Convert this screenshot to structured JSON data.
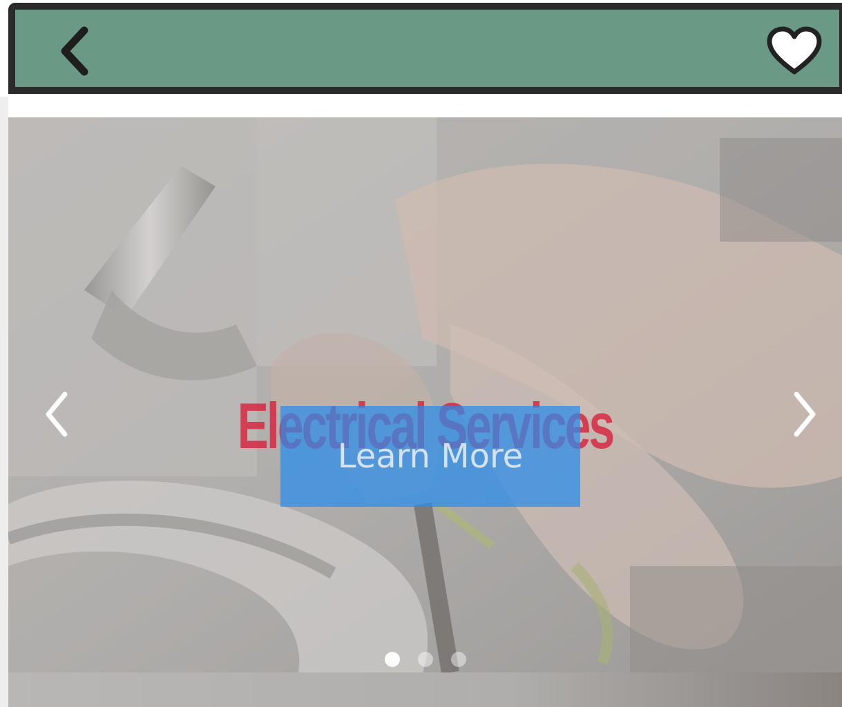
{
  "header": {
    "back_icon": "chevron-left-icon",
    "favorite_icon": "heart-icon",
    "background_color": "#6a9a85",
    "border_color": "#2b2b2b"
  },
  "carousel": {
    "title": "Electrical Services",
    "cta_label": "Learn More",
    "prev_icon": "chevron-left-icon",
    "next_icon": "chevron-right-icon",
    "slide_count": 3,
    "active_slide": 1,
    "title_color": "#d8243f",
    "cta_color": "#288ceb"
  }
}
